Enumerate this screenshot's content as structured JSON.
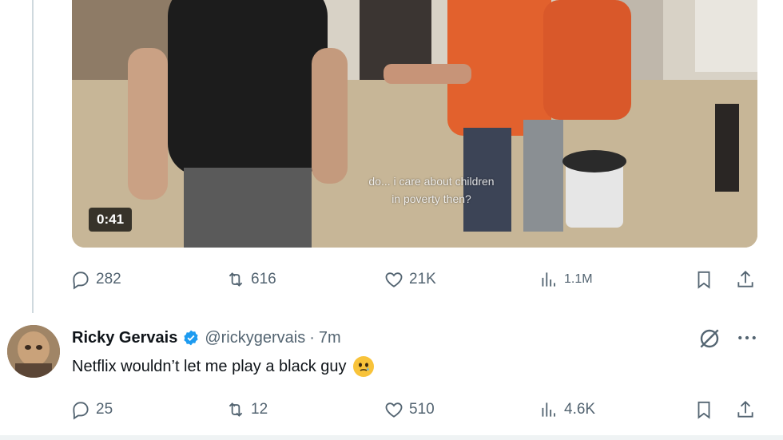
{
  "video": {
    "duration": "0:41",
    "caption_line1": "do... i care about children",
    "caption_line2": "in poverty then?"
  },
  "top_actions": {
    "replies": "282",
    "reposts": "616",
    "likes": "21K",
    "views": "1.1M"
  },
  "tweet": {
    "name": "Ricky Gervais",
    "handle": "@rickygervais",
    "separator": "·",
    "time": "7m",
    "text": "Netflix wouldn’t let me play a black guy",
    "emoji": "face-holding-back-tears",
    "replies": "25",
    "reposts": "12",
    "likes": "510",
    "views": "4.6K"
  },
  "colors": {
    "icon_gray": "#536471",
    "text": "#0f1419",
    "verified_blue": "#1d9bf0",
    "thread_line": "#cfd9de"
  }
}
